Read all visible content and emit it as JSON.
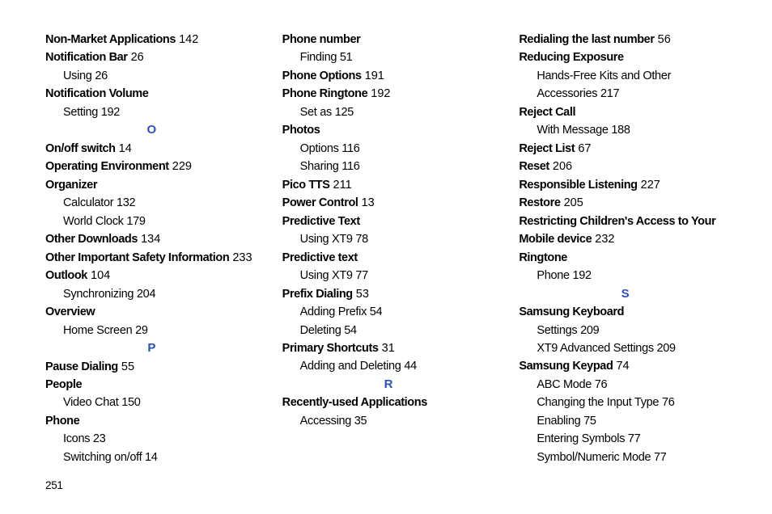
{
  "footer": "251",
  "columns": [
    [
      {
        "type": "topic",
        "label": "Non-Market Applications",
        "page": "142"
      },
      {
        "type": "topic",
        "label": "Notification Bar",
        "page": "26"
      },
      {
        "type": "sub",
        "label": "Using",
        "page": "26"
      },
      {
        "type": "topic",
        "label": "Notification Volume"
      },
      {
        "type": "sub",
        "label": "Setting",
        "page": "192"
      },
      {
        "type": "letter",
        "label": "O"
      },
      {
        "type": "topic",
        "label": "On/off switch",
        "page": "14"
      },
      {
        "type": "topic",
        "label": "Operating Environment",
        "page": "229"
      },
      {
        "type": "topic",
        "label": "Organizer"
      },
      {
        "type": "sub",
        "label": "Calculator",
        "page": "132"
      },
      {
        "type": "sub",
        "label": "World Clock",
        "page": "179"
      },
      {
        "type": "topic",
        "label": "Other Downloads",
        "page": "134"
      },
      {
        "type": "topic",
        "label": "Other Important Safety Information",
        "page": "233"
      },
      {
        "type": "topic",
        "label": "Outlook",
        "page": "104"
      },
      {
        "type": "sub",
        "label": "Synchronizing",
        "page": "204"
      },
      {
        "type": "topic",
        "label": "Overview"
      },
      {
        "type": "sub",
        "label": "Home Screen",
        "page": "29"
      },
      {
        "type": "letter",
        "label": "P"
      },
      {
        "type": "topic",
        "label": "Pause Dialing",
        "page": "55"
      },
      {
        "type": "topic",
        "label": "People"
      },
      {
        "type": "sub",
        "label": "Video Chat",
        "page": "150"
      },
      {
        "type": "topic",
        "label": "Phone"
      },
      {
        "type": "sub",
        "label": "Icons",
        "page": "23"
      },
      {
        "type": "sub",
        "label": "Switching on/off",
        "page": "14"
      }
    ],
    [
      {
        "type": "topic",
        "label": "Phone number"
      },
      {
        "type": "sub",
        "label": "Finding",
        "page": "51"
      },
      {
        "type": "topic",
        "label": "Phone Options",
        "page": "191"
      },
      {
        "type": "topic",
        "label": "Phone Ringtone",
        "page": "192"
      },
      {
        "type": "sub",
        "label": "Set as",
        "page": "125"
      },
      {
        "type": "topic",
        "label": "Photos"
      },
      {
        "type": "sub",
        "label": "Options",
        "page": "116"
      },
      {
        "type": "sub",
        "label": "Sharing",
        "page": "116"
      },
      {
        "type": "topic",
        "label": "Pico TTS",
        "page": "211"
      },
      {
        "type": "topic",
        "label": "Power Control",
        "page": "13"
      },
      {
        "type": "topic",
        "label": "Predictive Text"
      },
      {
        "type": "sub",
        "label": "Using XT9",
        "page": "78"
      },
      {
        "type": "topic",
        "label": "Predictive text"
      },
      {
        "type": "sub",
        "label": "Using XT9",
        "page": "77"
      },
      {
        "type": "topic",
        "label": "Prefix Dialing",
        "page": "53"
      },
      {
        "type": "sub",
        "label": "Adding Prefix",
        "page": "54"
      },
      {
        "type": "sub",
        "label": "Deleting",
        "page": "54"
      },
      {
        "type": "topic",
        "label": "Primary Shortcuts",
        "page": "31"
      },
      {
        "type": "sub",
        "label": "Adding and Deleting",
        "page": "44"
      },
      {
        "type": "letter",
        "label": "R"
      },
      {
        "type": "topic",
        "label": "Recently-used Applications"
      },
      {
        "type": "sub",
        "label": "Accessing",
        "page": "35"
      }
    ],
    [
      {
        "type": "topic",
        "label": "Redialing the last number",
        "page": "56"
      },
      {
        "type": "topic",
        "label": "Reducing Exposure"
      },
      {
        "type": "sub",
        "label": "Hands-Free Kits and Other Accessories",
        "page": "217"
      },
      {
        "type": "topic",
        "label": "Reject Call"
      },
      {
        "type": "sub",
        "label": "With Message",
        "page": "188"
      },
      {
        "type": "topic",
        "label": "Reject List",
        "page": "67"
      },
      {
        "type": "topic",
        "label": "Reset",
        "page": "206"
      },
      {
        "type": "topic",
        "label": "Responsible Listening",
        "page": "227"
      },
      {
        "type": "topic",
        "label": "Restore",
        "page": "205"
      },
      {
        "type": "topic",
        "label": "Restricting Children's Access to Your Mobile device",
        "page": "232"
      },
      {
        "type": "topic",
        "label": "Ringtone"
      },
      {
        "type": "sub",
        "label": "Phone",
        "page": "192"
      },
      {
        "type": "letter",
        "label": "S"
      },
      {
        "type": "topic",
        "label": "Samsung Keyboard"
      },
      {
        "type": "sub",
        "label": "Settings",
        "page": "209"
      },
      {
        "type": "sub",
        "label": "XT9 Advanced Settings",
        "page": "209"
      },
      {
        "type": "topic",
        "label": "Samsung Keypad",
        "page": "74"
      },
      {
        "type": "sub",
        "label": "ABC Mode",
        "page": "76"
      },
      {
        "type": "sub",
        "label": "Changing the Input Type",
        "page": "76"
      },
      {
        "type": "sub",
        "label": "Enabling",
        "page": "75"
      },
      {
        "type": "sub",
        "label": "Entering Symbols",
        "page": "77"
      },
      {
        "type": "sub",
        "label": "Symbol/Numeric Mode",
        "page": "77"
      }
    ]
  ]
}
